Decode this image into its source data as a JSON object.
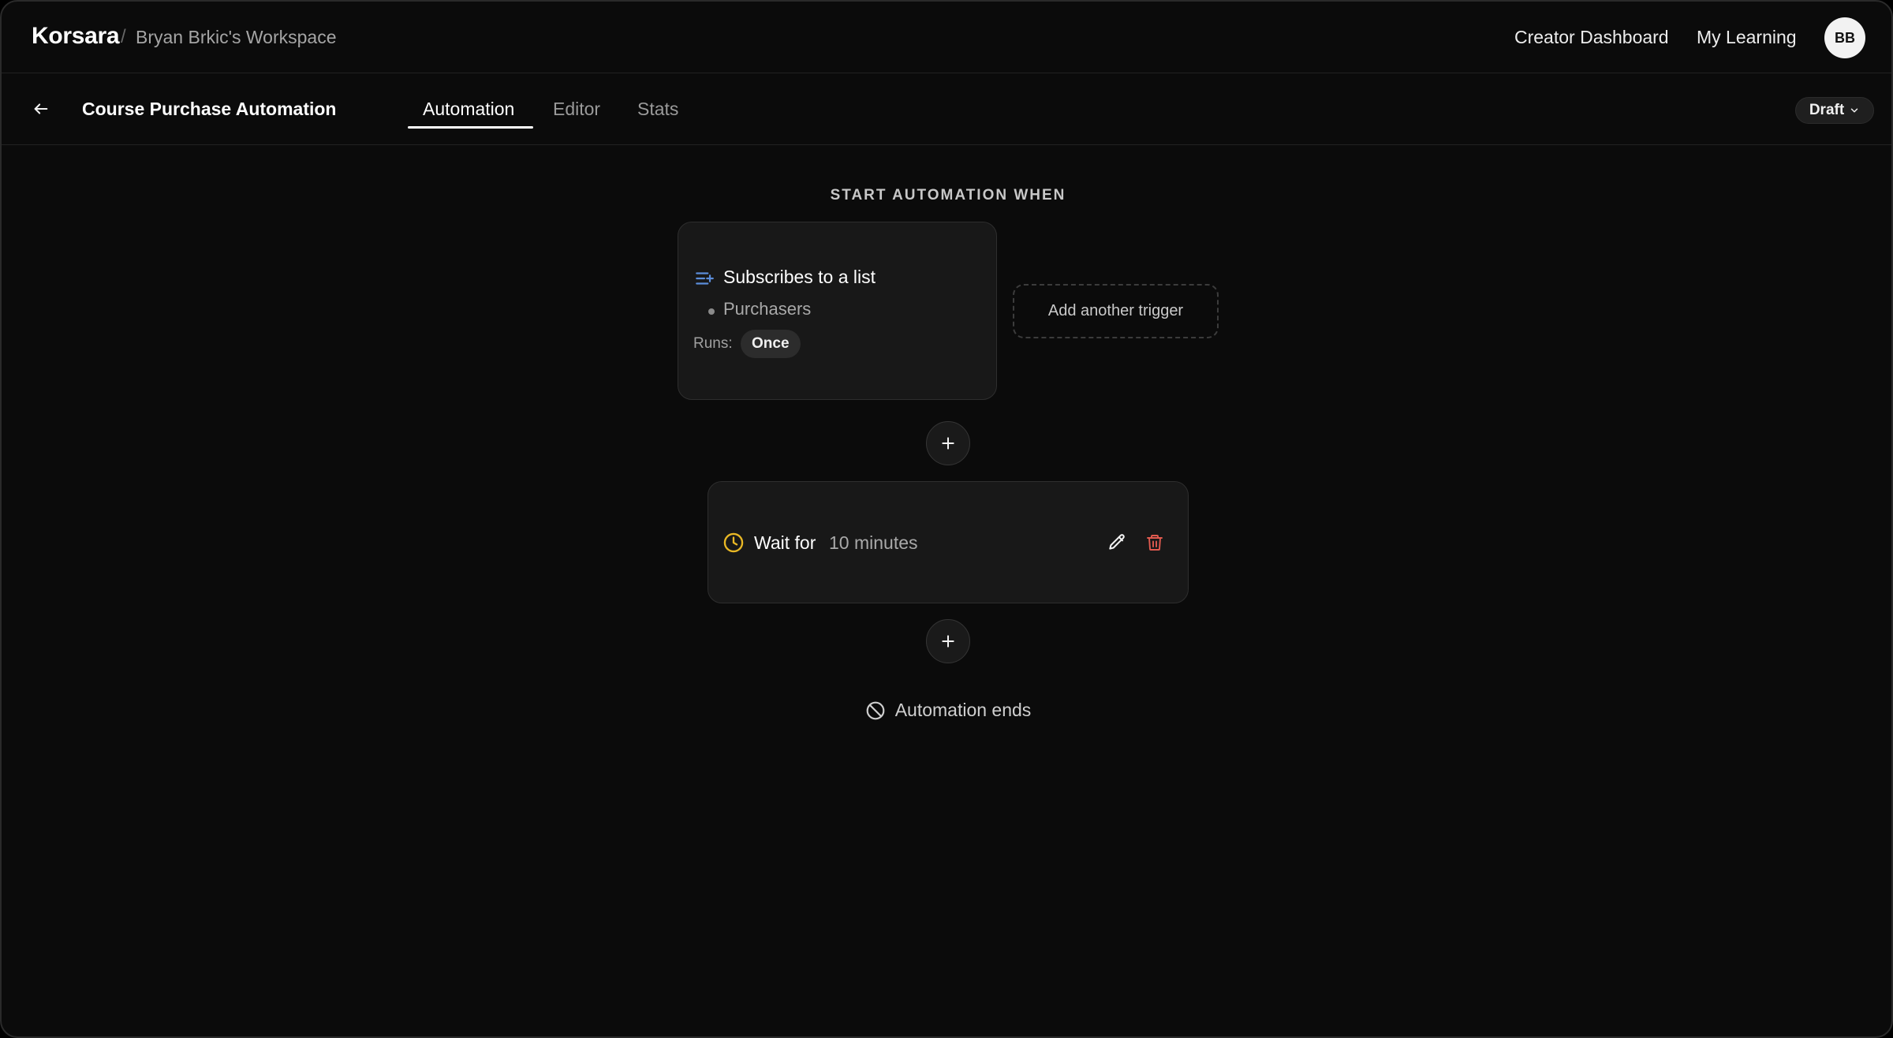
{
  "header": {
    "brand": "Korsara",
    "separator": "/",
    "workspace": "Bryan Brkic's Workspace",
    "nav": {
      "creator_dashboard": "Creator Dashboard",
      "my_learning": "My Learning"
    },
    "avatar_initials": "BB"
  },
  "subheader": {
    "title": "Course Purchase Automation",
    "tabs": [
      {
        "label": "Automation",
        "active": true
      },
      {
        "label": "Editor",
        "active": false
      },
      {
        "label": "Stats",
        "active": false
      }
    ],
    "status": "Draft"
  },
  "automation": {
    "section_label": "START AUTOMATION WHEN",
    "trigger": {
      "icon": "list-add-icon",
      "title": "Subscribes to a list",
      "list_name": "Purchasers",
      "runs_label": "Runs:",
      "runs_value": "Once"
    },
    "add_trigger_label": "Add another trigger",
    "steps": [
      {
        "icon": "clock-icon",
        "label": "Wait for",
        "value": "10 minutes"
      }
    ],
    "end_label": "Automation ends"
  },
  "colors": {
    "background": "#0b0b0b",
    "card": "#181818",
    "trigger_icon": "#5b8dd9",
    "wait_icon": "#e9b825",
    "delete_icon": "#e05a4f",
    "text_primary": "#ffffff",
    "text_muted": "#a9a9a9"
  }
}
